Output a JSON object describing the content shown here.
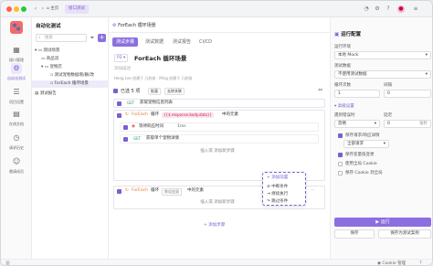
{
  "titlebar": {
    "home_label": "主页",
    "tab_label": "接口测试",
    "colors": {
      "dot_red": "#ff5f57",
      "dot_yellow": "#febc2e",
      "dot_green": "#28c840"
    }
  },
  "rail": {
    "items": [
      {
        "label": "接口管理",
        "icon": "api-icon"
      },
      {
        "label": "自动化测试",
        "icon": "automation-icon"
      },
      {
        "label": "项目设置",
        "icon": "settings-icon"
      },
      {
        "label": "在线文档",
        "icon": "doc-icon"
      },
      {
        "label": "请求历史",
        "icon": "history-icon"
      },
      {
        "label": "邀请成员",
        "icon": "invite-icon"
      }
    ]
  },
  "tree": {
    "title": "自动化测试",
    "search_placeholder": "搜索",
    "rows": [
      "测试场景",
      "商品流",
      "宠物店",
      "测试宠物数据增/删/改",
      "ForEach 循环场景",
      "测试报告"
    ]
  },
  "main": {
    "doc_tab": "ForEach 循环场景",
    "tabs": [
      "测试步骤",
      "测试数据",
      "测试报告",
      "CI/CD"
    ],
    "env": "P2",
    "title": "ForEach 循环场景",
    "desc_placeholder": "添加描述",
    "meta": "Heng Lee 创建于 几秒前 · Ming 创建于 几秒前",
    "selected": "已选 5 项",
    "select_all": "批量",
    "unlink": "去除关联",
    "steps": [
      {
        "method": "GET",
        "name": "获取宠物信息列表"
      },
      {
        "kind": "ForEach",
        "label": "循环",
        "expr": "{{$.response.body.data}}",
        "suffix": "中的元素"
      },
      {
        "kind": "wait",
        "label": "等待响应时间",
        "value": "1ms"
      },
      {
        "method": "GET",
        "name": "获取单个宠物详情"
      },
      {
        "add": "插入或 添加新步骤"
      },
      {
        "kind": "ForEach",
        "label": "循环",
        "expr": "数组变量",
        "suffix": "中的元素"
      },
      {
        "add": "插入或 添加新步骤"
      }
    ],
    "add_step": "添加步骤",
    "popup": {
      "title": "添加前置",
      "items": [
        "中断条件",
        "继续执行",
        "跳过条件"
      ]
    }
  },
  "right": {
    "title": "运行配置",
    "env_label": "运行环境",
    "env_value": "本地 Mock",
    "data_label": "测试数据",
    "data_value": "不使用测试数据",
    "loop_label": "循环次数",
    "loop_value": "1",
    "interval_label": "间隔",
    "interval_value": "0",
    "advanced": "高级设置",
    "error_label": "遇到错误时",
    "error_value": "忽略",
    "delay_label": "延迟",
    "delay_value": "0",
    "delay_unit": "毫秒",
    "save_detail": "保存请求/响应详情",
    "save_detail_value": "全部请求",
    "save_var": "保存变量值变更",
    "use_cookie": "使用全局 Cookie",
    "save_cookie": "保存 Cookie 到全局",
    "run_button": "运行",
    "save_button": "保存",
    "save_as": "保存为测试案例"
  },
  "status": {
    "cookie": "Cookie 管理",
    "accent": "#8b6fe0"
  }
}
